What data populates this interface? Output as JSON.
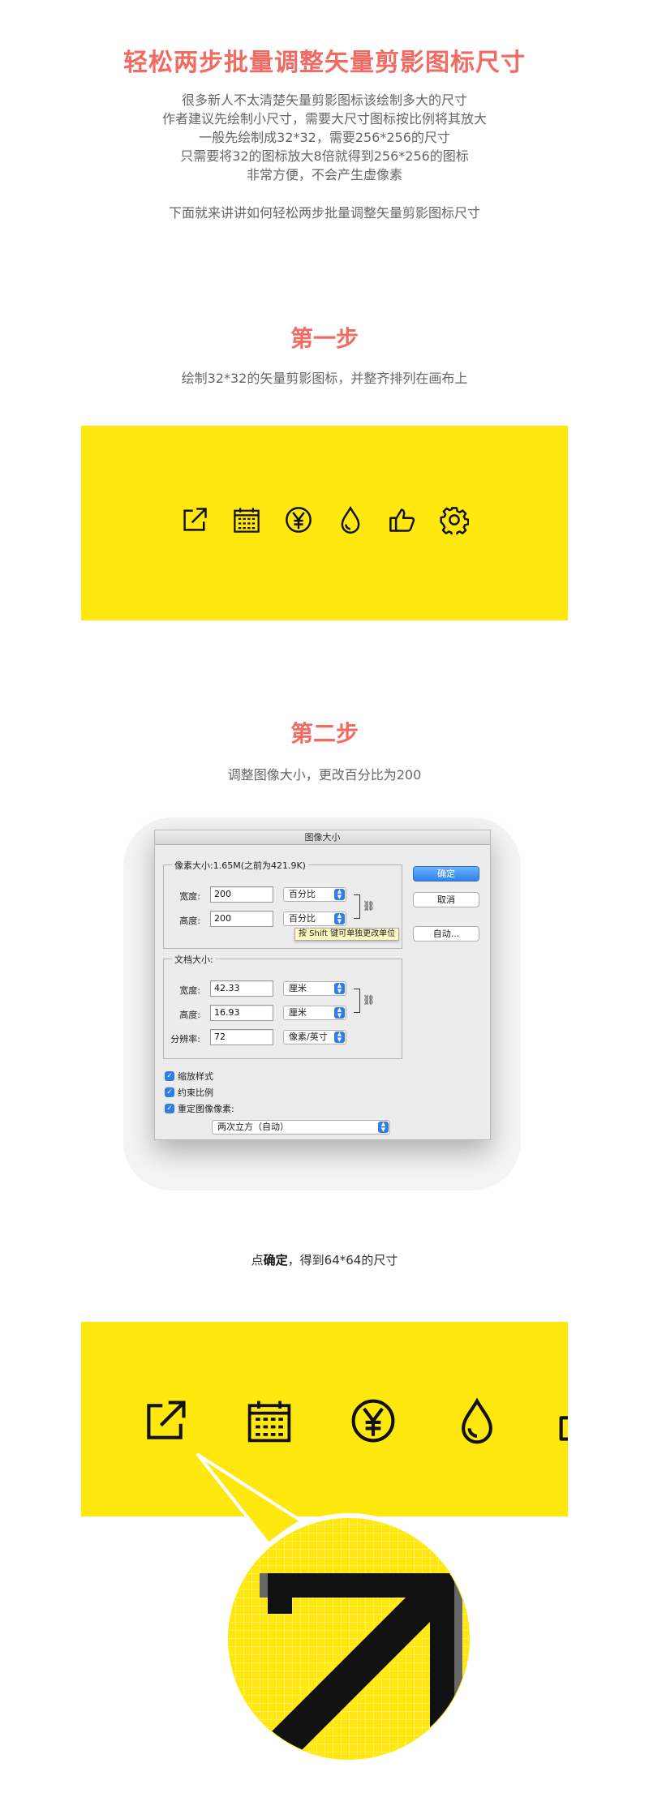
{
  "header": {
    "title": "轻松两步批量调整矢量剪影图标尺寸",
    "intro_lines": [
      "很多新人不太清楚矢量剪影图标该绘制多大的尺寸",
      "作者建议先绘制小尺寸，需要大尺寸图标按比例将其放大",
      "一般先绘制成32*32，需要256*256的尺寸",
      "只需要将32的图标放大8倍就得到256*256的图标",
      "非常方便，不会产生虚像素"
    ],
    "intro_follow": "下面就来讲讲如何轻松两步批量调整矢量剪影图标尺寸"
  },
  "step1": {
    "title": "第一步",
    "desc": "绘制32*32的矢量剪影图标，并整齐排列在画布上",
    "icons": [
      "external-link-icon",
      "calendar-icon",
      "yen-icon",
      "drop-icon",
      "thumbs-up-icon",
      "gear-icon"
    ]
  },
  "step2": {
    "title": "第二步",
    "desc": "调整图像大小，更改百分比为200"
  },
  "dialog": {
    "title": "图像大小",
    "pixel_legend": "像素大小:1.65M(之前为421.9K)",
    "width_label": "宽度:",
    "width_value": "200",
    "width_unit": "百分比",
    "height_label": "高度:",
    "height_value": "200",
    "height_unit": "百分比",
    "tooltip": "按 Shift 键可单独更改单位",
    "doc_legend": "文档大小:",
    "doc_width_label": "宽度:",
    "doc_width_value": "42.33",
    "doc_width_unit": "厘米",
    "doc_height_label": "高度:",
    "doc_height_value": "16.93",
    "doc_height_unit": "厘米",
    "resolution_label": "分辨率:",
    "resolution_value": "72",
    "resolution_unit": "像素/英寸",
    "ok_label": "确定",
    "cancel_label": "取消",
    "auto_label": "自动...",
    "scale_styles_label": "缩放样式",
    "constrain_label": "约束比例",
    "resample_label": "重定图像像素:",
    "resample_method": "两次立方（自动）"
  },
  "result": {
    "prefix": "点",
    "bold": "确定",
    "suffix": "，得到64*64的尺寸"
  },
  "colors": {
    "accent": "#f26b63",
    "yellow": "#ffe80d",
    "icon": "#111111",
    "dialog_blue": "#2f7de8"
  }
}
